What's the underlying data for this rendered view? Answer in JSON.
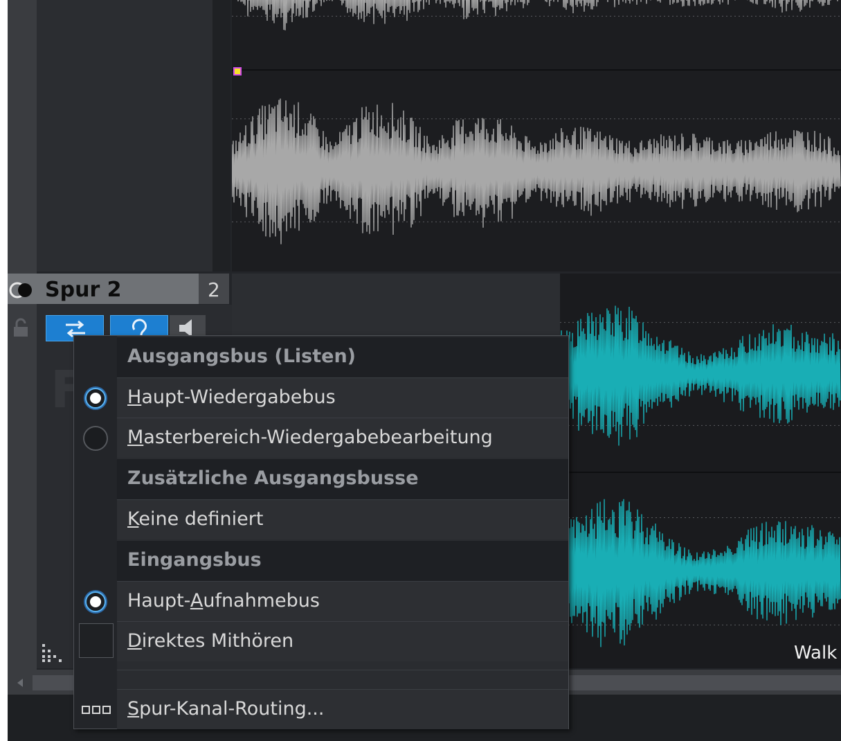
{
  "track2": {
    "name": "Spur 2",
    "number": "2",
    "header_letter": "F"
  },
  "clip": {
    "label": "Walk"
  },
  "context_menu": {
    "sections": [
      {
        "header": "Ausgangsbus (Listen)",
        "items": [
          {
            "pre": "",
            "mnemonic": "H",
            "post": "aupt-Wiedergabebus",
            "selected": true
          },
          {
            "pre": "",
            "mnemonic": "M",
            "post": "asterbereich-Wiedergabebearbeitung",
            "selected": false
          }
        ]
      },
      {
        "header": "Zusätzliche Ausgangsbusse",
        "items": [
          {
            "pre": "",
            "mnemonic": "K",
            "post": "eine definiert"
          }
        ]
      },
      {
        "header": "Eingangsbus",
        "items": [
          {
            "pre": "Haupt-",
            "mnemonic": "A",
            "post": "ufnahmebus",
            "selected": true
          },
          {
            "pre": "",
            "mnemonic": "D",
            "post": "irektes Mithören",
            "checked": false
          }
        ]
      }
    ],
    "footer_item": {
      "pre": "",
      "mnemonic": "S",
      "post": "pur-Kanal-Routing..."
    }
  },
  "colors": {
    "accent_blue": "#1d7fd1",
    "waveform_grey": "#a8a8a8",
    "waveform_cyan": "#19aeb5",
    "marker_fill": "#f5e12a",
    "marker_border": "#d24ce8"
  },
  "icons": {
    "toggle": "mono-stereo-toggle-icon",
    "lock": "lock-icon",
    "routing_button": "routing-arrows-icon",
    "monitor_button": "ear-icon",
    "speaker_button": "speaker-icon",
    "grip": "grip-dots-icon",
    "channel_routing": "channel-routing-icon"
  }
}
